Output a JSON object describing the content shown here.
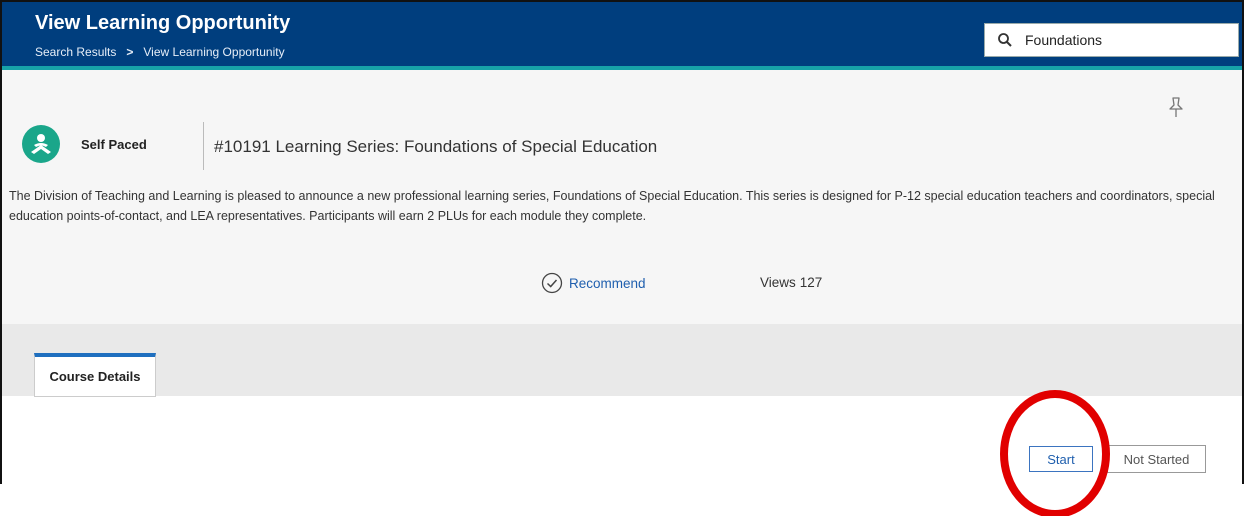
{
  "header": {
    "title": "View Learning Opportunity",
    "breadcrumb": {
      "parent": "Search Results",
      "separator": ">",
      "current": "View Learning Opportunity"
    }
  },
  "search": {
    "value": "Foundations",
    "icon": "search-icon"
  },
  "course": {
    "mode": "Self Paced",
    "title": "#10191 Learning Series: Foundations of Special Education",
    "description": "The Division of Teaching and Learning is pleased to announce a new professional learning series, Foundations of Special Education. This series is designed for P-12 special education teachers and coordinators, special education points-of-contact, and LEA representatives. Participants will earn 2 PLUs for each module they complete.",
    "recommend_label": "Recommend",
    "views_label": "Views",
    "views_count": "127"
  },
  "tabs": [
    {
      "label": "Course Details",
      "active": true
    }
  ],
  "actions": {
    "start_label": "Start",
    "status_label": "Not Started"
  },
  "colors": {
    "header_bg": "#003e7e",
    "accent": "#17a2a8",
    "avatar_bg": "#1aa68a",
    "link": "#1f5fae",
    "annotation_circle": "#e10000"
  }
}
